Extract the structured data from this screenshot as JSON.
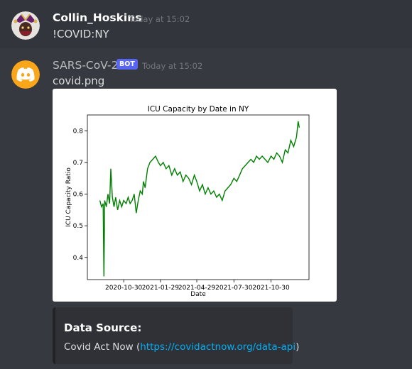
{
  "messages": [
    {
      "username": "Collin_Hoskins",
      "timestamp": "Today at 15:02",
      "content": "!COVID:NY",
      "avatar_icon": "jester-avatar-icon"
    },
    {
      "username": "SARS-CoV-2",
      "badge": "BOT",
      "timestamp": "Today at 15:02",
      "attachment_name": "covid.png",
      "avatar_icon": "discord-logo-icon",
      "avatar_color": "#faa61a",
      "embed": {
        "title": "Data Source:",
        "description_prefix": "Covid Act Now (",
        "link": "https://covidactnow.org/data-api",
        "description_suffix": ")"
      }
    }
  ],
  "chart_data": {
    "type": "line",
    "title": "ICU Capacity by Date in NY",
    "xlabel": "Date",
    "ylabel": "ICU Capacity Ratio",
    "x_tick_labels": [
      "2020-10-30",
      "2021-01-29",
      "2021-04-29",
      "2021-07-30",
      "2021-10-30"
    ],
    "y_tick_labels": [
      "0.4",
      "0.5",
      "0.6",
      "0.7",
      "0.8"
    ],
    "ylim": [
      0.33,
      0.85
    ],
    "xlim": [
      "2020-08-01",
      "2022-02-01"
    ],
    "line_color": "#008000",
    "series": [
      {
        "x": [
          "2020-09-01",
          "2020-09-05",
          "2020-09-09",
          "2020-09-11",
          "2020-09-13",
          "2020-09-17",
          "2020-09-21",
          "2020-09-25",
          "2020-09-28",
          "2020-10-02",
          "2020-10-06",
          "2020-10-10",
          "2020-10-15",
          "2020-10-20",
          "2020-10-25",
          "2020-10-30",
          "2020-11-05",
          "2020-11-10",
          "2020-11-15",
          "2020-11-20",
          "2020-11-25",
          "2020-11-30",
          "2020-12-05",
          "2020-12-10",
          "2020-12-15",
          "2020-12-18",
          "2020-12-22",
          "2020-12-28",
          "2021-01-03",
          "2021-01-10",
          "2021-01-17",
          "2021-01-24",
          "2021-01-29",
          "2021-02-05",
          "2021-02-12",
          "2021-02-19",
          "2021-02-26",
          "2021-03-05",
          "2021-03-12",
          "2021-03-19",
          "2021-03-26",
          "2021-04-02",
          "2021-04-09",
          "2021-04-16",
          "2021-04-23",
          "2021-04-29",
          "2021-05-06",
          "2021-05-13",
          "2021-05-20",
          "2021-05-27",
          "2021-06-03",
          "2021-06-10",
          "2021-06-17",
          "2021-06-24",
          "2021-07-01",
          "2021-07-08",
          "2021-07-15",
          "2021-07-22",
          "2021-07-30",
          "2021-08-06",
          "2021-08-13",
          "2021-08-20",
          "2021-08-27",
          "2021-09-03",
          "2021-09-10",
          "2021-09-17",
          "2021-09-24",
          "2021-10-01",
          "2021-10-08",
          "2021-10-15",
          "2021-10-22",
          "2021-10-30",
          "2021-11-06",
          "2021-11-13",
          "2021-11-20",
          "2021-11-27",
          "2021-12-04",
          "2021-12-11",
          "2021-12-18",
          "2021-12-25",
          "2022-01-01",
          "2022-01-05",
          "2022-01-08"
        ],
        "y": [
          0.58,
          0.56,
          0.57,
          0.34,
          0.58,
          0.56,
          0.6,
          0.57,
          0.68,
          0.59,
          0.56,
          0.59,
          0.55,
          0.58,
          0.56,
          0.58,
          0.57,
          0.59,
          0.57,
          0.58,
          0.6,
          0.54,
          0.58,
          0.61,
          0.6,
          0.64,
          0.62,
          0.68,
          0.7,
          0.71,
          0.72,
          0.7,
          0.69,
          0.7,
          0.68,
          0.69,
          0.66,
          0.68,
          0.66,
          0.67,
          0.64,
          0.66,
          0.65,
          0.63,
          0.66,
          0.64,
          0.61,
          0.63,
          0.6,
          0.62,
          0.6,
          0.61,
          0.59,
          0.6,
          0.58,
          0.61,
          0.62,
          0.63,
          0.65,
          0.64,
          0.66,
          0.68,
          0.69,
          0.7,
          0.71,
          0.7,
          0.72,
          0.71,
          0.72,
          0.71,
          0.7,
          0.72,
          0.71,
          0.73,
          0.72,
          0.7,
          0.74,
          0.73,
          0.77,
          0.75,
          0.78,
          0.83,
          0.81
        ]
      }
    ]
  }
}
